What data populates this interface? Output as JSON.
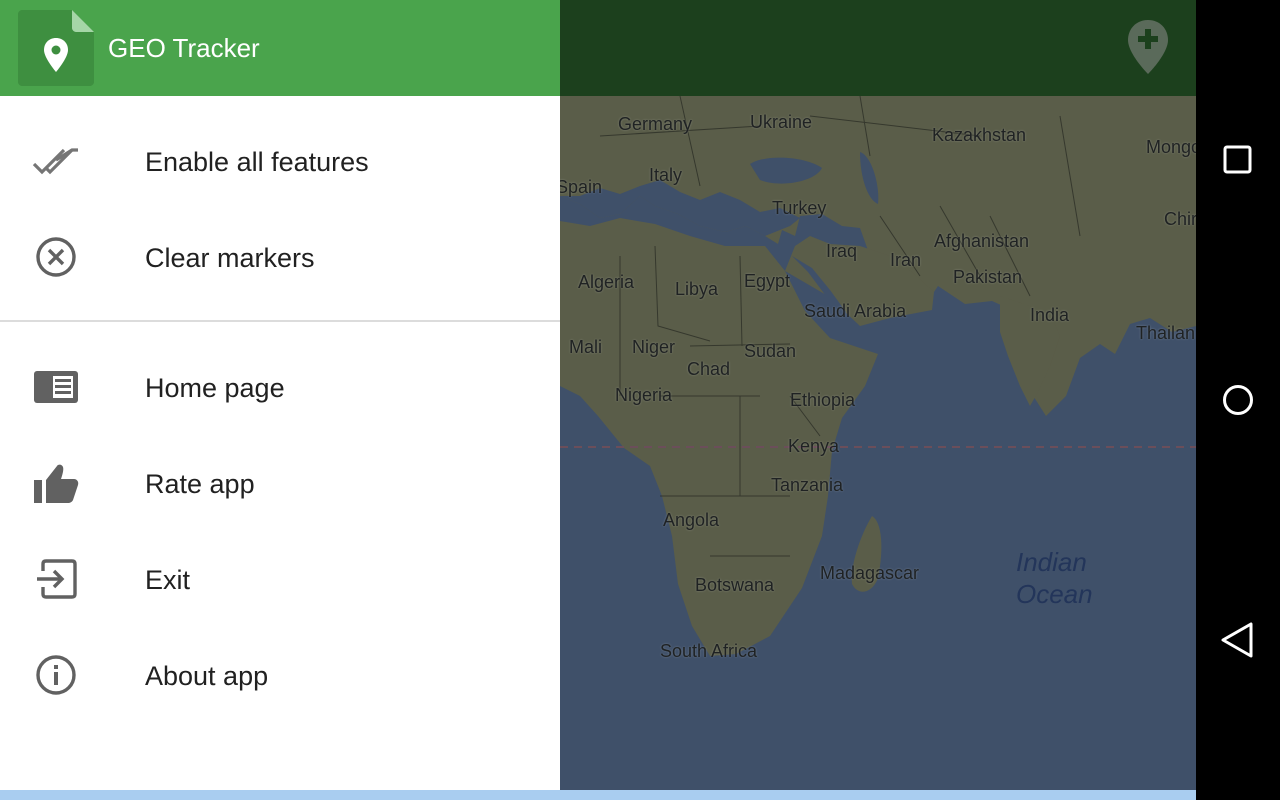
{
  "app": {
    "title": "GEO Tracker"
  },
  "drawer": {
    "primary_items": [
      {
        "label": "Enable all features",
        "icon": "double-check-icon"
      },
      {
        "label": "Clear markers",
        "icon": "clear-circle-icon"
      }
    ],
    "secondary_items": [
      {
        "label": "Home page",
        "icon": "home-page-icon"
      },
      {
        "label": "Rate app",
        "icon": "thumbs-up-icon"
      },
      {
        "label": "Exit",
        "icon": "exit-icon"
      },
      {
        "label": "About app",
        "icon": "info-icon"
      }
    ]
  },
  "map": {
    "labels": {
      "germany": "Germany",
      "ukraine": "Ukraine",
      "kazakhstan": "Kazakhstan",
      "mongolia": "Mongo",
      "spain": "Spain",
      "italy": "Italy",
      "turkey": "Turkey",
      "china": "Chir",
      "iraq": "Iraq",
      "iran": "Iran",
      "afghanistan": "Afghanistan",
      "pakistan": "Pakistan",
      "algeria": "Algeria",
      "libya": "Libya",
      "egypt": "Egypt",
      "saudi": "Saudi Arabia",
      "india": "India",
      "thailand": "Thailan",
      "mali": "Mali",
      "niger": "Niger",
      "sudan": "Sudan",
      "chad": "Chad",
      "nigeria": "Nigeria",
      "ethiopia": "Ethiopia",
      "kenya": "Kenya",
      "tanzania": "Tanzania",
      "angola": "Angola",
      "madagascar": "Madagascar",
      "botswana": "Botswana",
      "south_africa": "South Africa",
      "ocean_line1": "Indian",
      "ocean_line2": "Ocean"
    }
  },
  "colors": {
    "header_green": "#4aa44c",
    "toolbar_dark_green": "#1c401d",
    "ocean_dimmed": "#3f5069",
    "land_dimmed": "#5a5d49",
    "icon_grey": "#616161"
  }
}
